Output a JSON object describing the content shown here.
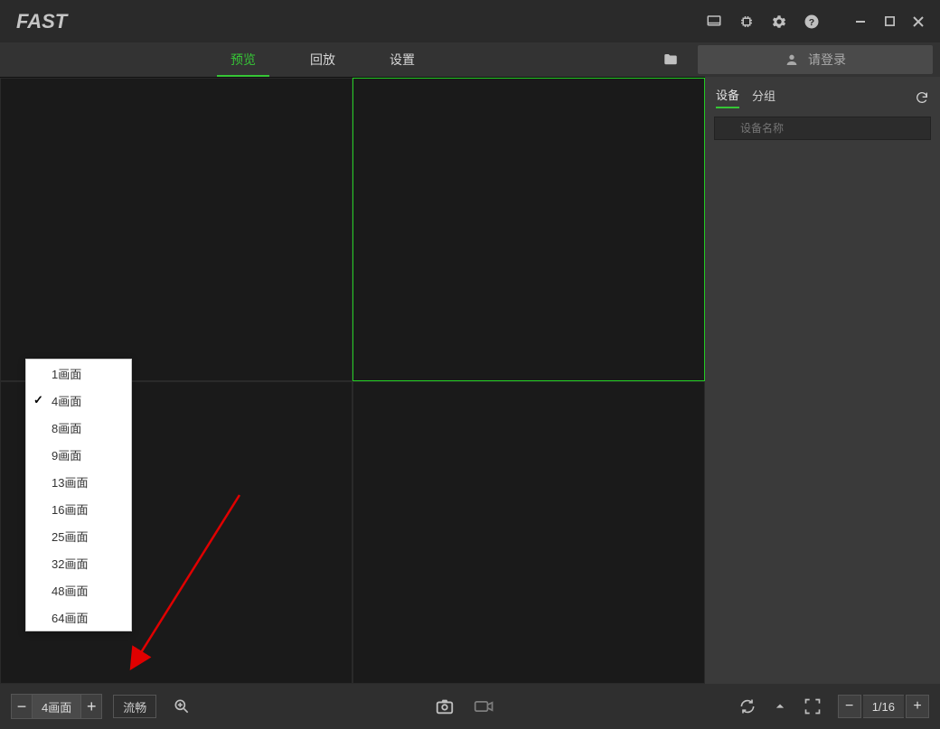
{
  "app": {
    "name": "FAST"
  },
  "nav": {
    "tabs": [
      "预览",
      "回放",
      "设置"
    ],
    "active": 0
  },
  "login_label": "请登录",
  "side": {
    "tabs": [
      "设备",
      "分组"
    ],
    "active": 0,
    "search_placeholder": "设备名称"
  },
  "layout_popup": {
    "items": [
      "1画面",
      "4画面",
      "8画面",
      "9画面",
      "13画面",
      "16画面",
      "25画面",
      "32画面",
      "48画面",
      "64画面"
    ],
    "selected": 1
  },
  "bottombar": {
    "layout_label": "4画面",
    "stream_label": "流畅",
    "page_text": "1/16"
  }
}
